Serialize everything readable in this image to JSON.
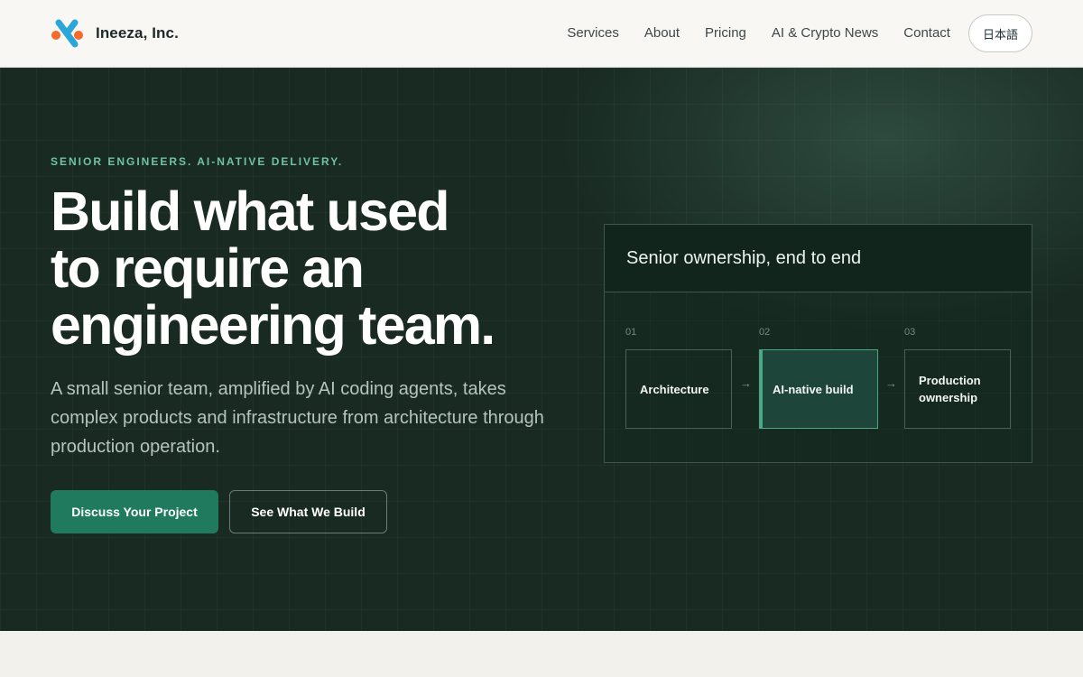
{
  "header": {
    "brand": "Ineeza, Inc.",
    "nav": [
      "Services",
      "About",
      "Pricing",
      "AI & Crypto News",
      "Contact"
    ],
    "language_button": "日本語"
  },
  "hero": {
    "eyebrow": "SENIOR ENGINEERS. AI-NATIVE DELIVERY.",
    "headline_lines": [
      "Build what used",
      "to require an",
      "engineering team."
    ],
    "subtext": "A small senior team, amplified by AI coding agents, takes complex products and infrastructure from architecture through production operation.",
    "primary_button": "Discuss Your Project",
    "secondary_button": "See What We Build"
  },
  "card": {
    "title": "Senior ownership, end to end",
    "steps": [
      {
        "number": "01",
        "label": "Architecture"
      },
      {
        "number": "02",
        "label": "AI-native build"
      },
      {
        "number": "03",
        "label": "Production ownership"
      }
    ],
    "arrow_glyph": "→",
    "active_step_index": 1
  },
  "colors": {
    "hero_bg": "#182a22",
    "accent_green": "#1f7a5e",
    "eyebrow_green": "#6fc3a2",
    "logo_blue": "#2aa7d8",
    "logo_orange": "#f26a2e"
  }
}
